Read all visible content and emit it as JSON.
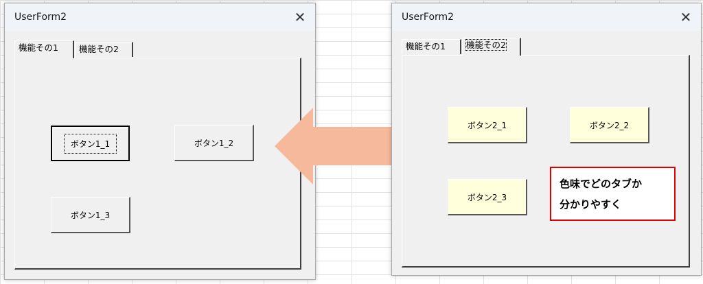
{
  "left_form": {
    "title": "UserForm2",
    "close_glyph": "✕",
    "tabs": [
      {
        "label": "機能その1",
        "active": true
      },
      {
        "label": "機能その2",
        "active": false
      }
    ],
    "buttons": [
      {
        "label": "ボタン1_1",
        "default": true
      },
      {
        "label": "ボタン1_2",
        "default": false
      },
      {
        "label": "ボタン1_3",
        "default": false
      }
    ]
  },
  "right_form": {
    "title": "UserForm2",
    "close_glyph": "✕",
    "tabs": [
      {
        "label": "機能その1",
        "active": false
      },
      {
        "label": "機能その2",
        "active": true
      }
    ],
    "buttons": [
      {
        "label": "ボタン2_1",
        "background": "#ffffdc"
      },
      {
        "label": "ボタン2_2",
        "background": "#ffffdc"
      },
      {
        "label": "ボタン2_3",
        "background": "#ffffdc"
      }
    ]
  },
  "annotation": {
    "lines": [
      "色味でどのタブか",
      "分かりやすく"
    ],
    "border_color": "#e00000"
  },
  "arrow": {
    "icon": "double-arrow",
    "color": "#f7b99b"
  }
}
